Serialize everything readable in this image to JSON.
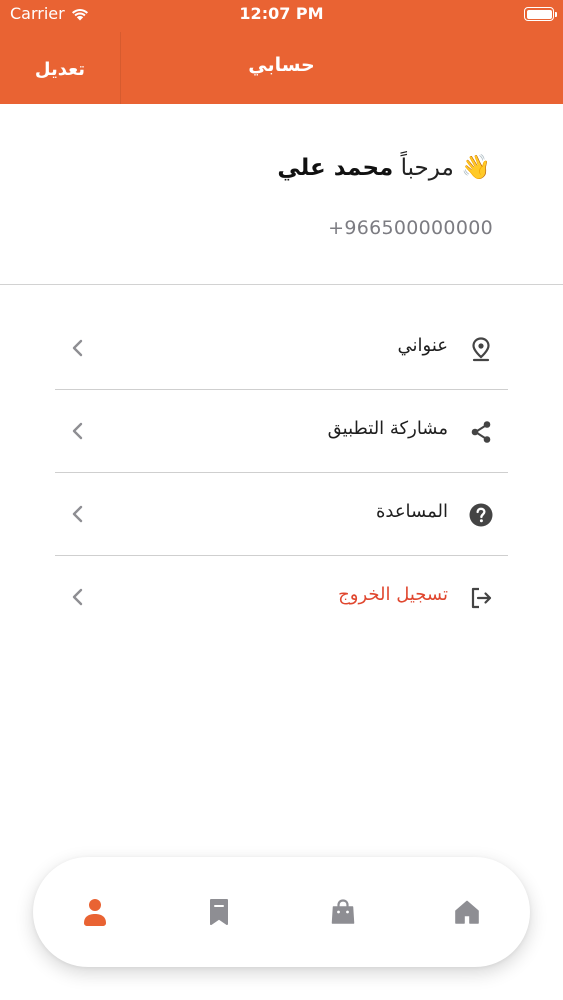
{
  "status_bar": {
    "carrier": "Carrier",
    "time": "12:07 PM"
  },
  "header": {
    "title": "حسابي",
    "edit_label": "تعديل",
    "background": "#E96333"
  },
  "profile": {
    "greeting_emoji": "👋",
    "greeting": "مرحباً",
    "name": "محمد علي",
    "phone": "+966500000000"
  },
  "menu": {
    "items": [
      {
        "label": "عنواني",
        "icon": "location-pin-icon"
      },
      {
        "label": "مشاركة التطبيق",
        "icon": "share-icon"
      },
      {
        "label": "المساعدة",
        "icon": "help-icon"
      },
      {
        "label": "تسجيل الخروج",
        "icon": "logout-icon",
        "color": "#E0472F"
      }
    ]
  },
  "tabbar": {
    "tabs": [
      {
        "icon": "user-icon",
        "active": true,
        "color": "#E96333"
      },
      {
        "icon": "bookmark-icon",
        "active": false,
        "color": "#8e8e93"
      },
      {
        "icon": "shopping-bag-icon",
        "active": false,
        "color": "#8e8e93"
      },
      {
        "icon": "home-icon",
        "active": false,
        "color": "#8e8e93"
      }
    ]
  }
}
